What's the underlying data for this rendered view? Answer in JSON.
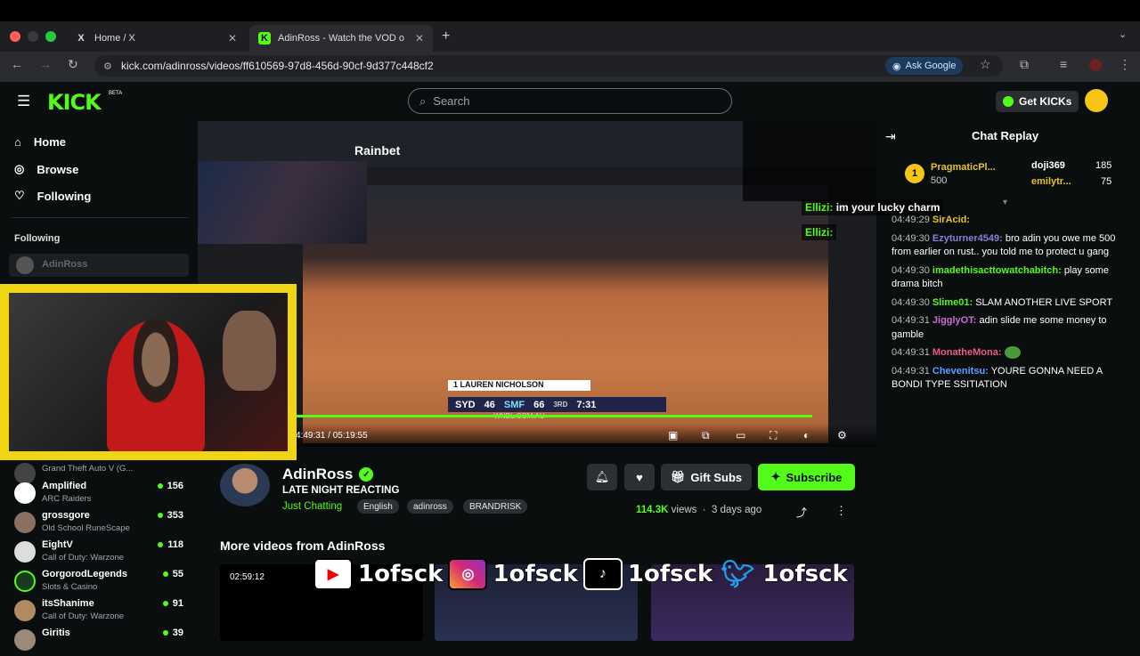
{
  "browser": {
    "tabs": [
      {
        "label": "Home / X",
        "icon": "X"
      },
      {
        "label": "AdinRoss - Watch the VOD o",
        "icon": "K"
      }
    ],
    "url": "kick.com/adinross/videos/ff610569-97d8-456d-90cf-9d377c448cf2",
    "ask_google": "Ask Google"
  },
  "header": {
    "logo": "KICK",
    "beta": "BETA",
    "search_placeholder": "Search",
    "get_kicks": "Get KICKs"
  },
  "sidebar": {
    "nav": [
      {
        "label": "Home",
        "icon": "home-icon"
      },
      {
        "label": "Browse",
        "icon": "compass-icon"
      },
      {
        "label": "Following",
        "icon": "heart-icon"
      }
    ],
    "following_title": "Following",
    "following_first": "AdinRoss",
    "channels": [
      {
        "name": "",
        "category": "Grand Theft Auto V (G...",
        "viewers": ""
      },
      {
        "name": "Amplified",
        "category": "ARC Raiders",
        "viewers": "156"
      },
      {
        "name": "grossgore",
        "category": "Old School RuneScape",
        "viewers": "353"
      },
      {
        "name": "EightV",
        "category": "Call of Duty: Warzone",
        "viewers": "118"
      },
      {
        "name": "GorgorodLegends",
        "category": "Slots & Casino",
        "viewers": "55"
      },
      {
        "name": "itsShanime",
        "category": "Call of Duty: Warzone",
        "viewers": "91"
      },
      {
        "name": "Giritis",
        "category": "",
        "viewers": "39"
      }
    ]
  },
  "video": {
    "stream_site": "Rainbet",
    "scoreboard_name": "1  LAUREN NICHOLSON",
    "team1": "SYD",
    "score1": "46",
    "team2": "SMF",
    "score2": "66",
    "quarter": "3RD",
    "clock": "7:31",
    "website": "WNBL.COM.AU",
    "time": "4:49:31 / 05:19:55",
    "progress": 0.906,
    "overlay_chat_1": "im your lucky charm",
    "overlay_user": "Ellizi:"
  },
  "channel": {
    "name": "AdinRoss",
    "title": "LATE NIGHT REACTING",
    "category": "Just Chatting",
    "tags": [
      "English",
      "adinross",
      "BRANDRISK"
    ],
    "gift_subs": "Gift Subs",
    "subscribe": "Subscribe",
    "views": "114.3K",
    "views_suffix": "views",
    "age": "3 days ago"
  },
  "more": {
    "title": "More videos from AdinRoss",
    "duration": "02:59:12"
  },
  "social": {
    "handle": "1ofsck"
  },
  "chat": {
    "title": "Chat Replay",
    "pinned": {
      "top_user": "PragmaticPl...",
      "top_amount": "500",
      "second_user": "doji369",
      "second_amount": "185",
      "third_user": "emilytr...",
      "third_amount": "75"
    },
    "messages": [
      {
        "time": "04:49:29",
        "user": "SirAcid:",
        "color": "#e6c229",
        "text": ""
      },
      {
        "time": "04:49:30",
        "user": "Ezyturner4549:",
        "color": "#8a7dd8",
        "text": "bro adin you owe me 500 from earlier on rust.. you told me to protect u gang"
      },
      {
        "time": "04:49:30",
        "user": "imadethisacttowatchabitch:",
        "color": "#53fc18",
        "text": "play some drama bitch"
      },
      {
        "time": "04:49:30",
        "user": "Slime01:",
        "color": "#53fc18",
        "text": "SLAM ANOTHER LIVE SPORT"
      },
      {
        "time": "04:49:31",
        "user": "JigglyOT:",
        "color": "#c86dd7",
        "text": "adin slide me some money to gamble"
      },
      {
        "time": "04:49:31",
        "user": "MonatheMona:",
        "color": "#e85a8a",
        "text": ""
      },
      {
        "time": "04:49:31",
        "user": "Chevenitsu:",
        "color": "#5aa0ff",
        "text": "YOURE GONNA NEED A BONDI TYPE SSITIATION"
      }
    ]
  }
}
